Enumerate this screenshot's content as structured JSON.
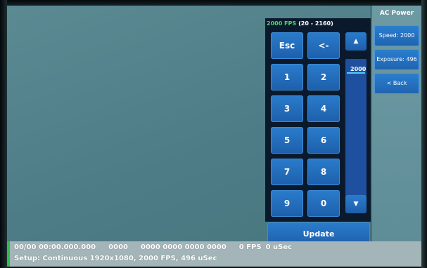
{
  "side_panel": {
    "title": "AC Power",
    "buttons": [
      {
        "label": "Speed: 2000"
      },
      {
        "label": "Exposure: 496"
      },
      {
        "label": "< Back"
      }
    ]
  },
  "keypad": {
    "header_value": "2000 FPS",
    "header_range": "(20 - 2160)",
    "keys": [
      "Esc",
      "<-",
      "1",
      "2",
      "3",
      "4",
      "5",
      "6",
      "7",
      "8",
      "9",
      "0"
    ],
    "slider_value": "2000",
    "slider_up": "▲",
    "slider_down": "▼",
    "update_label": "Update"
  },
  "status": {
    "line1": {
      "time": "00/00 00:00.000.000",
      "count": "0000",
      "codes": "0000 0000 0000 0000",
      "fps": "0 FPS",
      "exposure": "0 uSec"
    },
    "line2": "Setup: Continuous 1920x1080, 2000 FPS, 496 uSec"
  },
  "colors": {
    "accent_green": "#3fe25a",
    "button_blue": "#1f63b0",
    "status_bg": "#a3b5b8"
  }
}
